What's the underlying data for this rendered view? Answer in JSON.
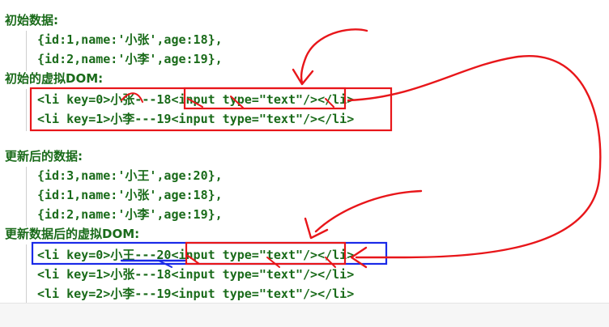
{
  "initial": {
    "heading": "初始数据:",
    "items": [
      "{id:1,name:'小张',age:18},",
      "{id:2,name:'小李',age:19},"
    ]
  },
  "initial_vdom": {
    "heading": "初始的虚拟DOM:",
    "items": [
      "<li key=0>小张---18<input type=\"text\"/></li>",
      "<li key=1>小李---19<input type=\"text\"/></li>"
    ]
  },
  "updated": {
    "heading": "更新后的数据:",
    "items": [
      "{id:3,name:'小王',age:20},",
      "{id:1,name:'小张',age:18},",
      "{id:2,name:'小李',age:19},"
    ]
  },
  "updated_vdom": {
    "heading": "更新数据后的虚拟DOM:",
    "items": [
      "<li key=0>小王---20<input type=\"text\"/></li>",
      "<li key=1>小张---18<input type=\"text\"/></li>",
      "<li key=2>小李---19<input type=\"text\"/></li>"
    ]
  },
  "colors": {
    "text": "#1a6b1a",
    "annotation_red": "#e8161a",
    "annotation_blue": "#1a2ae8"
  }
}
